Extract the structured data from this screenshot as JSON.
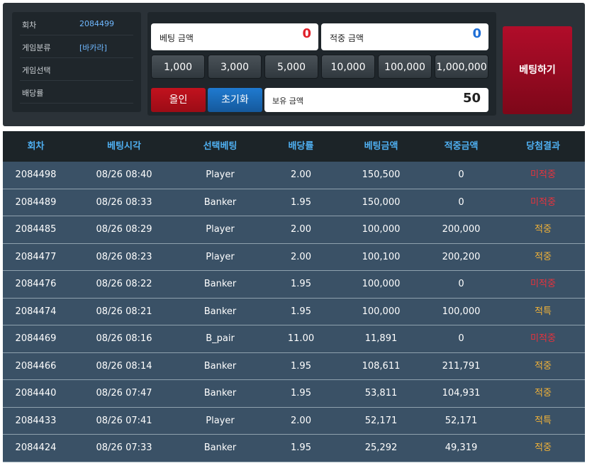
{
  "info": {
    "round_label": "회차",
    "round_value": "2084499",
    "category_label": "게임분류",
    "category_value": "[바카라]",
    "selection_label": "게임선택",
    "selection_value": "",
    "odds_label": "배당률",
    "odds_value": ""
  },
  "bet": {
    "amount_label": "베팅 금액",
    "amount_value": "0",
    "win_label": "적중 금액",
    "win_value": "0",
    "chips": [
      "1,000",
      "3,000",
      "5,000",
      "10,000",
      "100,000",
      "1,000,000"
    ],
    "allin_label": "올인",
    "reset_label": "초기화",
    "hold_label": "보유 금액",
    "hold_value": "50",
    "submit_label": "베팅하기"
  },
  "colors": {
    "bet_amount": "#e0202a",
    "win_amount": "#1f6fd6",
    "miss": "#e8323c",
    "hit": "#f1b238"
  },
  "history": {
    "headers": [
      "회차",
      "베팅시각",
      "선택베팅",
      "배당률",
      "베팅금액",
      "적중금액",
      "당첨결과"
    ],
    "rows": [
      {
        "round": "2084498",
        "time": "08/26 08:40",
        "pick": "Player",
        "odds": "2.00",
        "bet": "150,500",
        "win": "0",
        "result": "미적중",
        "status": "miss"
      },
      {
        "round": "2084489",
        "time": "08/26 08:33",
        "pick": "Banker",
        "odds": "1.95",
        "bet": "150,000",
        "win": "0",
        "result": "미적중",
        "status": "miss"
      },
      {
        "round": "2084485",
        "time": "08/26 08:29",
        "pick": "Player",
        "odds": "2.00",
        "bet": "100,000",
        "win": "200,000",
        "result": "적중",
        "status": "hit"
      },
      {
        "round": "2084477",
        "time": "08/26 08:23",
        "pick": "Player",
        "odds": "2.00",
        "bet": "100,100",
        "win": "200,200",
        "result": "적중",
        "status": "hit"
      },
      {
        "round": "2084476",
        "time": "08/26 08:22",
        "pick": "Banker",
        "odds": "1.95",
        "bet": "100,000",
        "win": "0",
        "result": "미적중",
        "status": "miss"
      },
      {
        "round": "2084474",
        "time": "08/26 08:21",
        "pick": "Banker",
        "odds": "1.95",
        "bet": "100,000",
        "win": "100,000",
        "result": "적특",
        "status": "hit"
      },
      {
        "round": "2084469",
        "time": "08/26 08:16",
        "pick": "B_pair",
        "odds": "11.00",
        "bet": "11,891",
        "win": "0",
        "result": "미적중",
        "status": "miss"
      },
      {
        "round": "2084466",
        "time": "08/26 08:14",
        "pick": "Banker",
        "odds": "1.95",
        "bet": "108,611",
        "win": "211,791",
        "result": "적중",
        "status": "hit"
      },
      {
        "round": "2084440",
        "time": "08/26 07:47",
        "pick": "Banker",
        "odds": "1.95",
        "bet": "53,811",
        "win": "104,931",
        "result": "적중",
        "status": "hit"
      },
      {
        "round": "2084433",
        "time": "08/26 07:41",
        "pick": "Player",
        "odds": "2.00",
        "bet": "52,171",
        "win": "52,171",
        "result": "적특",
        "status": "hit"
      },
      {
        "round": "2084424",
        "time": "08/26 07:33",
        "pick": "Banker",
        "odds": "1.95",
        "bet": "25,292",
        "win": "49,319",
        "result": "적중",
        "status": "hit"
      }
    ]
  }
}
